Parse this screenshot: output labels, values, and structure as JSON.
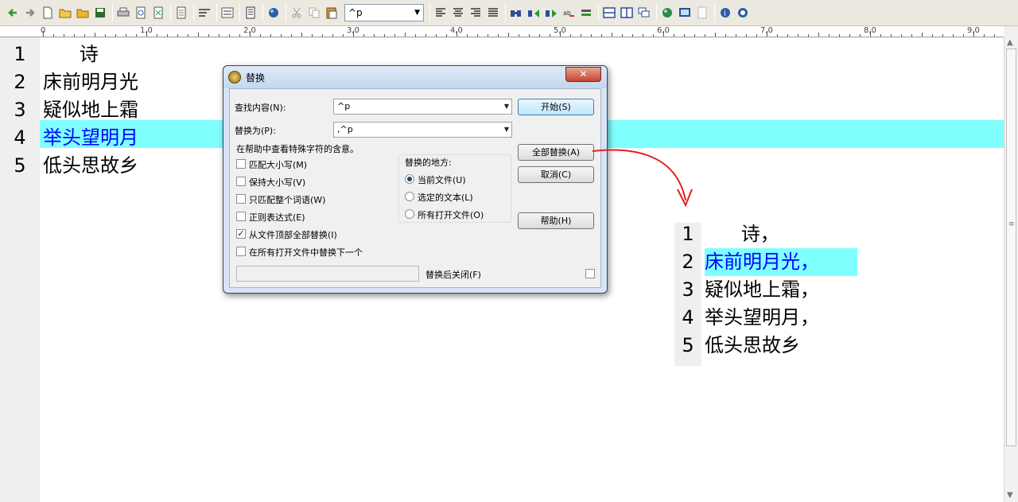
{
  "toolbar": {
    "search_value": "^p",
    "icons": [
      "back-arrow-icon",
      "forward-arrow-icon",
      "new-file-icon",
      "open-folder-icon",
      "open-folder-2-icon",
      "save-icon",
      "print-icon",
      "print-preview-icon",
      "export-icon",
      "page-icon",
      "wrap-icon",
      "hex-icon",
      "doc-icon",
      "globe-icon",
      "cut-icon",
      "copy-icon",
      "paste-icon",
      "align-left-icon",
      "align-center-icon",
      "align-right-icon",
      "justify-icon",
      "find-icon",
      "find-next-icon",
      "find-prev-icon",
      "replace-icon",
      "spell-icon",
      "split-h-icon",
      "split-v-icon",
      "cascade-icon",
      "web-icon",
      "screen-icon",
      "blank-icon",
      "info-icon",
      "help-icon"
    ]
  },
  "ruler": {
    "labels": [
      "0",
      "1,0",
      "2,0",
      "3,0",
      "4,0",
      "5,0",
      "6,0",
      "7,0",
      "8,0",
      "9,0"
    ]
  },
  "editor": {
    "lines": [
      {
        "num": "1",
        "text": "      诗"
      },
      {
        "num": "2",
        "text": "床前明月光"
      },
      {
        "num": "3",
        "text": "疑似地上霜"
      },
      {
        "num": "4",
        "text": "举头望明月"
      },
      {
        "num": "5",
        "text": "低头思故乡"
      }
    ],
    "highlight_color": "#80ffff",
    "selected_text_color": "#0000ff"
  },
  "dialog": {
    "title": "替换",
    "close_label": "✕",
    "find_label": "查找内容(N):",
    "find_value": "^p",
    "replace_label": "替换为(P):",
    "replace_value": ",^p",
    "hint": "在帮助中查看特殊字符的含意。",
    "options": [
      {
        "label": "匹配大小写(M)",
        "checked": false
      },
      {
        "label": "保持大小写(V)",
        "checked": false
      },
      {
        "label": "只匹配整个词语(W)",
        "checked": false
      },
      {
        "label": "正则表达式(E)",
        "checked": false
      },
      {
        "label": "从文件顶部全部替换(I)",
        "checked": true
      },
      {
        "label": "在所有打开文件中替换下一个",
        "checked": false
      }
    ],
    "scope_title": "替换的地方:",
    "scope_options": [
      {
        "label": "当前文件(U)",
        "selected": true
      },
      {
        "label": "选定的文本(L)",
        "selected": false
      },
      {
        "label": "所有打开文件(O)",
        "selected": false
      }
    ],
    "buttons": {
      "start": "开始(S)",
      "replace_all": "全部替换(A)",
      "cancel": "取消(C)",
      "help": "帮助(H)"
    },
    "close_after_label": "替换后关闭(F)"
  },
  "result": {
    "lines": [
      {
        "num": "1",
        "text": "      诗，"
      },
      {
        "num": "2",
        "text": "床前明月光，"
      },
      {
        "num": "3",
        "text": "疑似地上霜，"
      },
      {
        "num": "4",
        "text": "举头望明月，"
      },
      {
        "num": "5",
        "text": "低头思故乡"
      }
    ],
    "arrow_color": "#e02020"
  }
}
